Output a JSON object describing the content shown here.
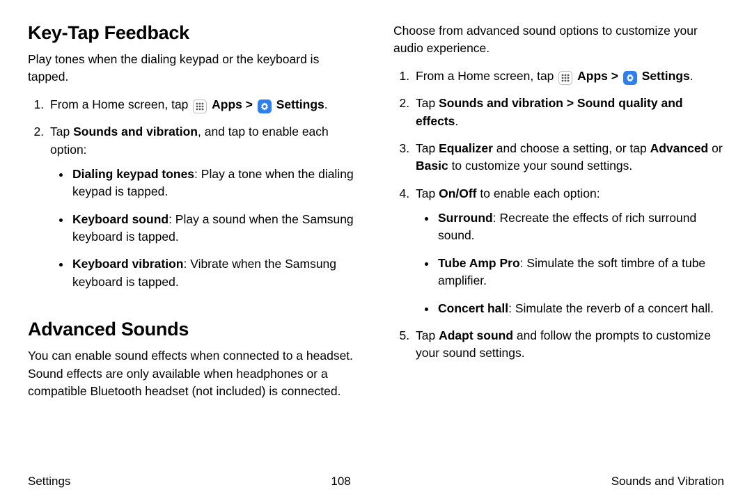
{
  "left": {
    "heading1": "Key-Tap Feedback",
    "intro1": "Play tones when the dialing keypad or the keyboard is tapped.",
    "step1_a": "From a Home screen, tap ",
    "step1_apps": "Apps",
    "step1_sep": " > ",
    "step1_settings": "Settings",
    "step1_end": ".",
    "step2_a": "Tap ",
    "step2_b": "Sounds and vibration",
    "step2_c": ", and tap to enable each option:",
    "b1_a": "Dialing keypad tones",
    "b1_b": ": Play a tone when the dialing keypad is tapped.",
    "b2_a": "Keyboard sound",
    "b2_b": ": Play a sound when the Samsung keyboard is tapped.",
    "b3_a": "Keyboard vibration",
    "b3_b": ": Vibrate when the Samsung keyboard is tapped.",
    "heading2": "Advanced Sounds",
    "intro2": "You can enable sound effects when connected to a headset. Sound effects are only available when headphones or a compatible Bluetooth headset (not included) is connected."
  },
  "right": {
    "intro": "Choose from advanced sound options to customize your audio experience.",
    "s1_a": "From a Home screen, tap ",
    "s1_apps": "Apps",
    "s1_sep": " > ",
    "s1_settings": "Settings",
    "s1_end": ".",
    "s2_a": "Tap ",
    "s2_b": "Sounds and vibration > Sound quality and effects",
    "s2_c": ".",
    "s3_a": "Tap ",
    "s3_b": "Equalizer",
    "s3_c": " and choose a setting, or tap ",
    "s3_d": "Advanced",
    "s3_e": " or ",
    "s3_f": "Basic",
    "s3_g": " to customize your sound settings.",
    "s4_a": "Tap ",
    "s4_b": "On/Off",
    "s4_c": " to enable each option:",
    "rb1_a": "Surround",
    "rb1_b": ": Recreate the effects of rich surround sound.",
    "rb2_a": "Tube Amp Pro",
    "rb2_b": ": Simulate the soft timbre of a tube amplifier.",
    "rb3_a": "Concert hall",
    "rb3_b": ": Simulate the reverb of a concert hall.",
    "s5_a": "Tap ",
    "s5_b": "Adapt sound",
    "s5_c": " and follow the prompts to customize your sound settings."
  },
  "footer": {
    "left": "Settings",
    "center": "108",
    "right": "Sounds and Vibration"
  }
}
